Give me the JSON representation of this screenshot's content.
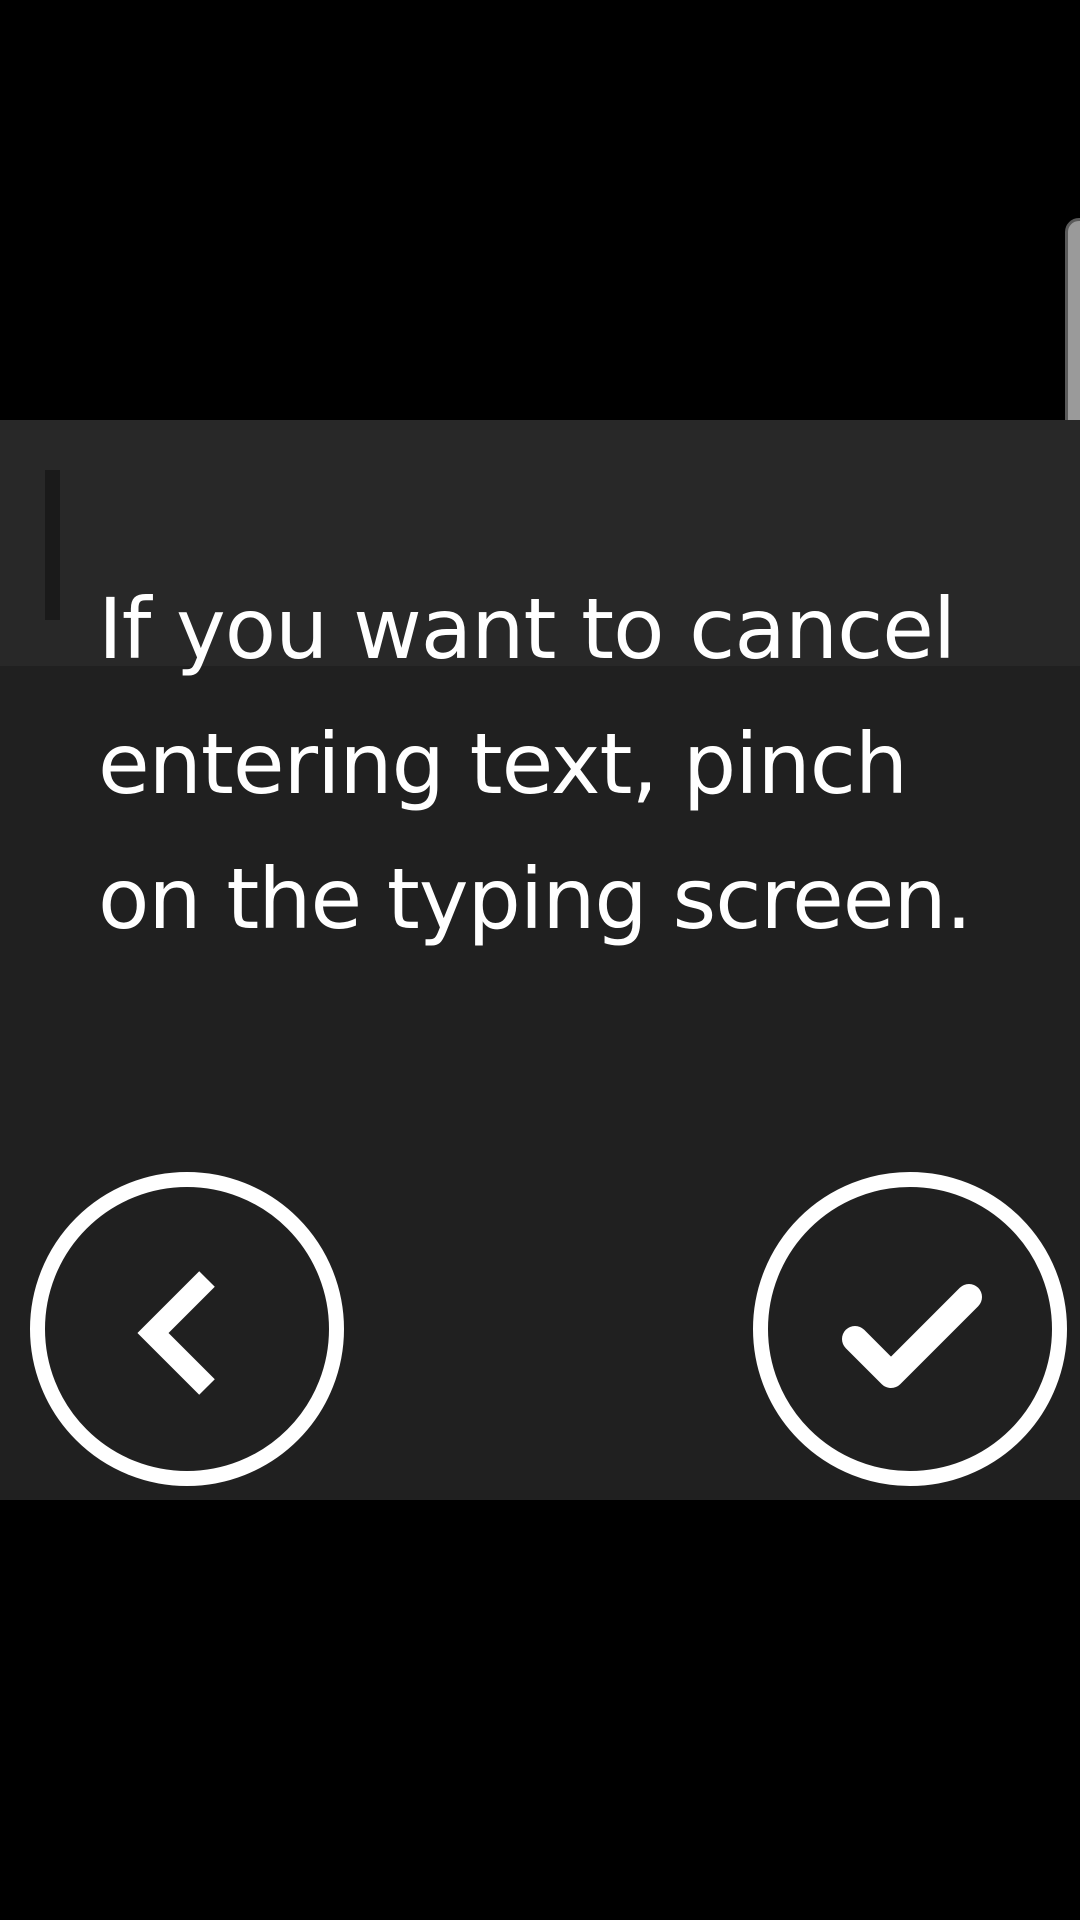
{
  "dialog": {
    "message": "If you want to cancel entering text, pinch on the typing screen.",
    "back_icon": "chevron-left-icon",
    "confirm_icon": "checkmark-icon"
  },
  "colors": {
    "background": "#000000",
    "dialog": "#202020",
    "dialog_top": "#282828",
    "foreground": "#ffffff"
  }
}
